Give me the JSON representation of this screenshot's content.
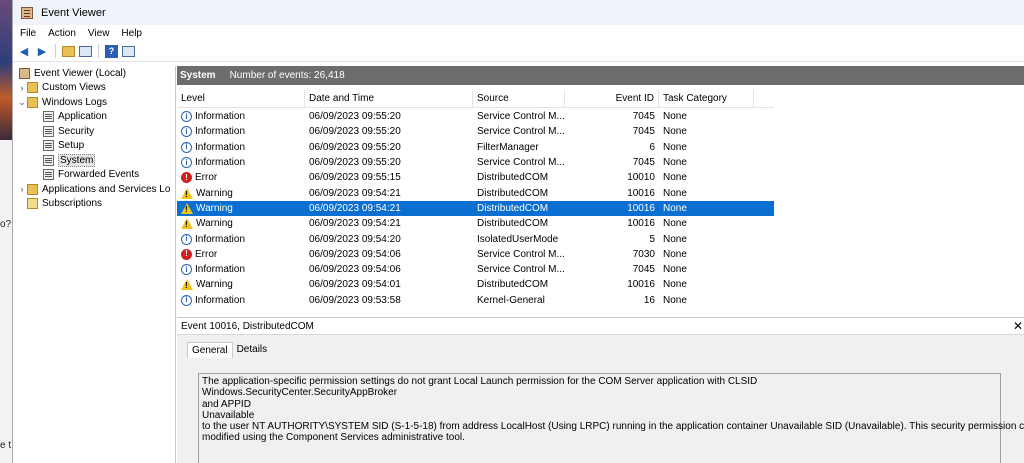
{
  "window": {
    "title": "Event Viewer"
  },
  "menu": [
    "File",
    "Action",
    "View",
    "Help"
  ],
  "tree": {
    "root": "Event Viewer (Local)",
    "custom_views": "Custom Views",
    "windows_logs": "Windows Logs",
    "logs": [
      "Application",
      "Security",
      "Setup",
      "System",
      "Forwarded Events"
    ],
    "apps_services": "Applications and Services Lo",
    "subscriptions": "Subscriptions"
  },
  "pane": {
    "name": "System",
    "count": "Number of events: 26,418"
  },
  "columns": {
    "level": "Level",
    "date": "Date and Time",
    "source": "Source",
    "event_id": "Event ID",
    "task": "Task Category"
  },
  "events": [
    {
      "level": "Information",
      "date": "06/09/2023 09:55:20",
      "source": "Service Control M...",
      "id": "7045",
      "task": "None"
    },
    {
      "level": "Information",
      "date": "06/09/2023 09:55:20",
      "source": "Service Control M...",
      "id": "7045",
      "task": "None"
    },
    {
      "level": "Information",
      "date": "06/09/2023 09:55:20",
      "source": "FilterManager",
      "id": "6",
      "task": "None"
    },
    {
      "level": "Information",
      "date": "06/09/2023 09:55:20",
      "source": "Service Control M...",
      "id": "7045",
      "task": "None"
    },
    {
      "level": "Error",
      "date": "06/09/2023 09:55:15",
      "source": "DistributedCOM",
      "id": "10010",
      "task": "None"
    },
    {
      "level": "Warning",
      "date": "06/09/2023 09:54:21",
      "source": "DistributedCOM",
      "id": "10016",
      "task": "None"
    },
    {
      "level": "Warning",
      "date": "06/09/2023 09:54:21",
      "source": "DistributedCOM",
      "id": "10016",
      "task": "None"
    },
    {
      "level": "Warning",
      "date": "06/09/2023 09:54:21",
      "source": "DistributedCOM",
      "id": "10016",
      "task": "None"
    },
    {
      "level": "Information",
      "date": "06/09/2023 09:54:20",
      "source": "IsolatedUserMode",
      "id": "5",
      "task": "None"
    },
    {
      "level": "Error",
      "date": "06/09/2023 09:54:06",
      "source": "Service Control M...",
      "id": "7030",
      "task": "None"
    },
    {
      "level": "Information",
      "date": "06/09/2023 09:54:06",
      "source": "Service Control M...",
      "id": "7045",
      "task": "None"
    },
    {
      "level": "Warning",
      "date": "06/09/2023 09:54:01",
      "source": "DistributedCOM",
      "id": "10016",
      "task": "None"
    },
    {
      "level": "Information",
      "date": "06/09/2023 09:53:58",
      "source": "Kernel-General",
      "id": "16",
      "task": "None"
    }
  ],
  "detail": {
    "title": "Event 10016, DistributedCOM",
    "tabs": [
      "General",
      "Details"
    ],
    "message": [
      "The application-specific permission settings do not grant Local Launch permission for the COM Server application with CLSID",
      "Windows.SecurityCenter.SecurityAppBroker",
      " and APPID",
      "Unavailable",
      " to the user NT AUTHORITY\\SYSTEM SID (S-1-5-18) from address LocalHost (Using LRPC) running in the application container Unavailable SID (Unavailable). This security permission can be",
      "modified using the Component Services administrative tool."
    ]
  },
  "background_fragments": [
    "o?",
    "e t"
  ],
  "colors": {
    "selection": "#0b6fd1",
    "pane_header": "#6d6d6d"
  }
}
